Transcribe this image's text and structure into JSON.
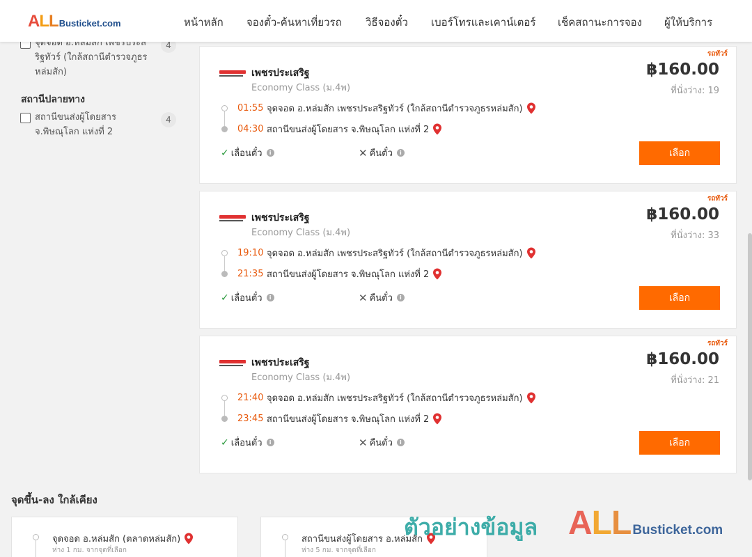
{
  "logo": {
    "all": "ALL",
    "rest": "Busticket.com"
  },
  "nav": [
    {
      "label": "หน้าหลัก"
    },
    {
      "label": "จองตั๋ว-ค้นหาเที่ยวรถ"
    },
    {
      "label": "วิธีจองตั๋ว"
    },
    {
      "label": "เบอร์โทรและเคาน์เตอร์"
    },
    {
      "label": "เช็คสถานะการจอง"
    },
    {
      "label": "ผู้ให้บริการ"
    }
  ],
  "sidebar": {
    "origin_option": {
      "label_line1": "จุดจอด อ.หล่มสัก เพชรประส",
      "label_line2": "ริฐทัวร์ (ใกล้สถานีตำรวจภูธร",
      "label_line3": "หล่มสัก)",
      "count": "4"
    },
    "destination_heading": "สถานีปลายทาง",
    "destination_option": {
      "label_line1": "สถานีขนส่งผู้โดยสาร",
      "label_line2": "จ.พิษณุโลก แห่งที่ 2",
      "count": "4"
    }
  },
  "trips": [
    {
      "tag": "รถทัวร์",
      "operator": "เพชรประเสริฐ",
      "class": "Economy Class (ม.4พ)",
      "price": "฿160.00",
      "seats": "ที่นั่งว่าง: 19",
      "depart_time": "01:55",
      "depart_place": "จุดจอด อ.หล่มสัก เพชรประสริฐทัวร์ (ใกล้สถานีตำรวจภูธรหล่มสัก)",
      "arrive_time": "04:30",
      "arrive_place": "สถานีขนส่งผู้โดยสาร จ.พิษณุโลก แห่งที่ 2",
      "reschedule": "เลื่อนตั๋ว",
      "refund": "คืนตั๋ว",
      "select": "เลือก"
    },
    {
      "tag": "รถทัวร์",
      "operator": "เพชรประเสริฐ",
      "class": "Economy Class (ม.4พ)",
      "price": "฿160.00",
      "seats": "ที่นั่งว่าง: 33",
      "depart_time": "19:10",
      "depart_place": "จุดจอด อ.หล่มสัก เพชรประสริฐทัวร์ (ใกล้สถานีตำรวจภูธรหล่มสัก)",
      "arrive_time": "21:35",
      "arrive_place": "สถานีขนส่งผู้โดยสาร จ.พิษณุโลก แห่งที่ 2",
      "reschedule": "เลื่อนตั๋ว",
      "refund": "คืนตั๋ว",
      "select": "เลือก"
    },
    {
      "tag": "รถทัวร์",
      "operator": "เพชรประเสริฐ",
      "class": "Economy Class (ม.4พ)",
      "price": "฿160.00",
      "seats": "ที่นั่งว่าง: 21",
      "depart_time": "21:40",
      "depart_place": "จุดจอด อ.หล่มสัก เพชรประสริฐทัวร์ (ใกล้สถานีตำรวจภูธรหล่มสัก)",
      "arrive_time": "23:45",
      "arrive_place": "สถานีขนส่งผู้โดยสาร จ.พิษณุโลก แห่งที่ 2",
      "reschedule": "เลื่อนตั๋ว",
      "refund": "คืนตั๋ว",
      "select": "เลือก"
    }
  ],
  "nearby": {
    "heading": "จุดขึ้น-ลง ใกล้เคียง",
    "items": [
      {
        "name": "จุดจอด อ.หล่มสัก (ตลาดหล่มสัก)",
        "distance": "ห่าง 1 กม. จากจุดที่เลือก"
      },
      {
        "name": "สถานีขนส่งผู้โดยสาร อ.หล่มสัก",
        "distance": "ห่าง 5 กม. จากจุดที่เลือก"
      }
    ]
  },
  "watermark": {
    "text": "ตัวอย่างข้อมูล",
    "logo_all": "ALL",
    "logo_rest": "Busticket.com"
  },
  "colors": {
    "accent": "#ff6a00",
    "time": "#e8590c",
    "check": "#2b9a3d",
    "pin": "#e03131"
  }
}
